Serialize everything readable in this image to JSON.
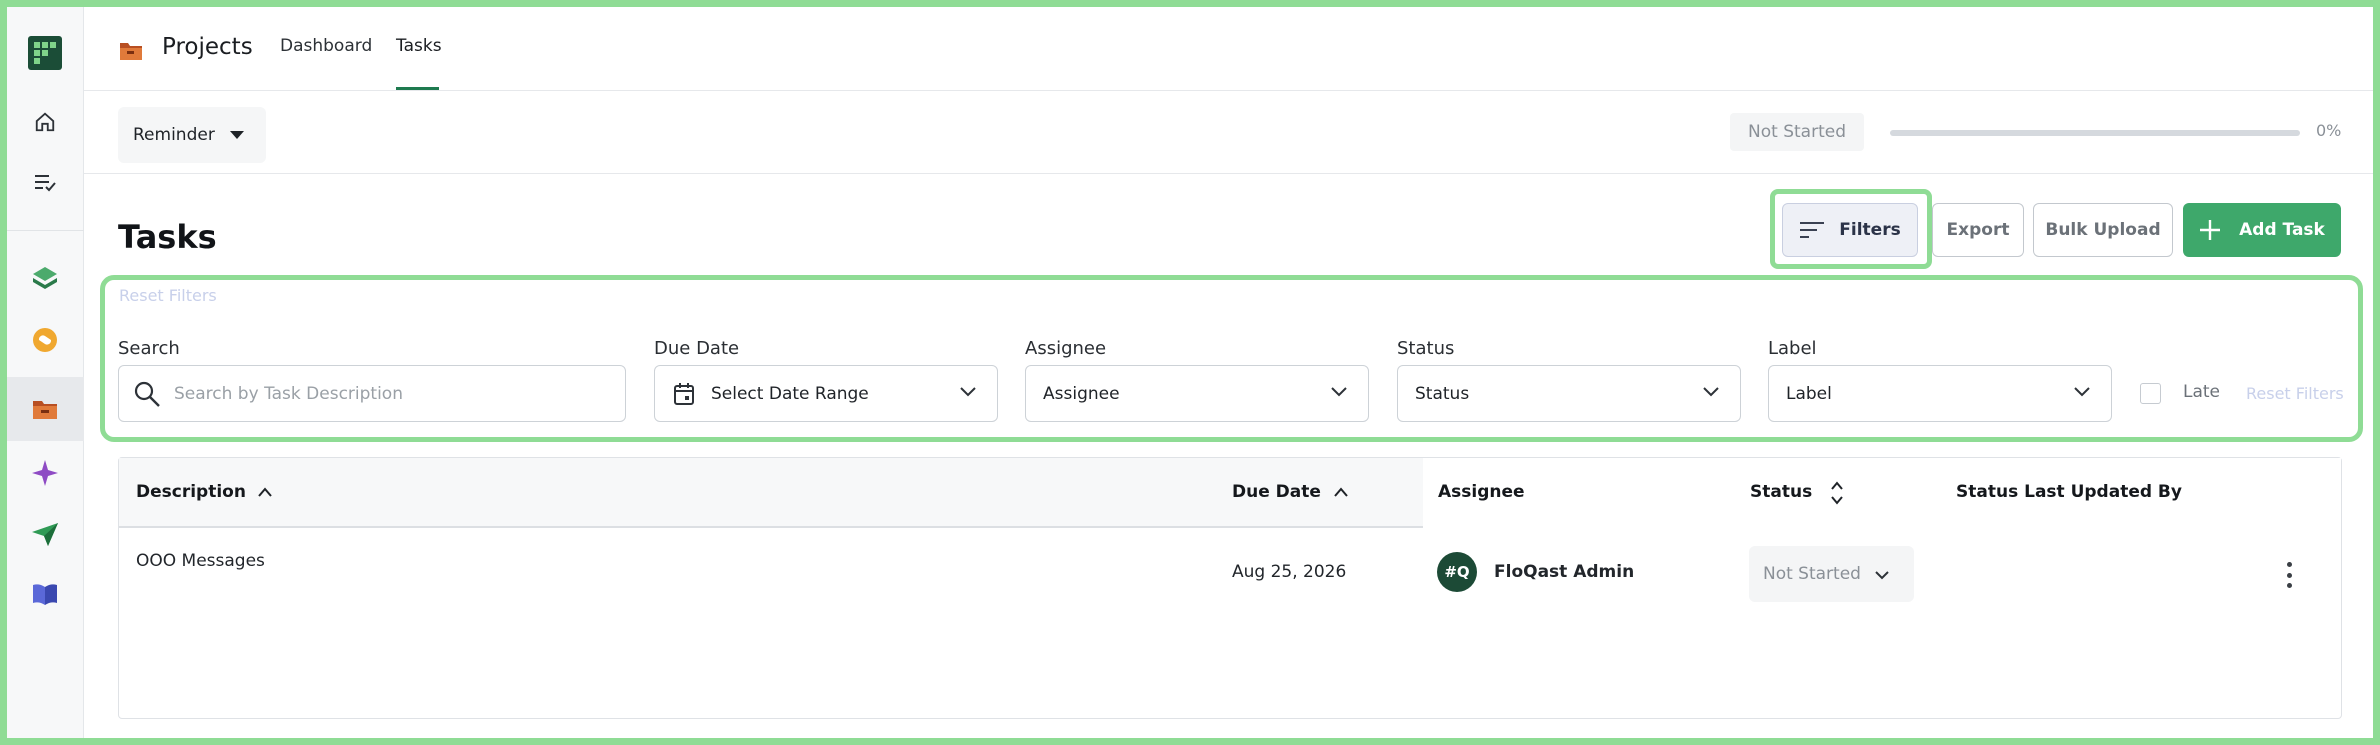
{
  "app": {
    "section_title": "Projects",
    "tabs": [
      {
        "label": "Dashboard",
        "active": false
      },
      {
        "label": "Tasks",
        "active": true
      }
    ]
  },
  "sidebar": {
    "items": [
      {
        "icon": "home-icon"
      },
      {
        "icon": "checklist-icon"
      },
      {
        "icon": "layers-icon"
      },
      {
        "icon": "link-icon"
      },
      {
        "icon": "folder-icon",
        "active": true
      },
      {
        "icon": "sparkle-icon"
      },
      {
        "icon": "send-icon"
      },
      {
        "icon": "book-icon"
      }
    ]
  },
  "reminder": {
    "label": "Reminder"
  },
  "project_status": {
    "label": "Not Started",
    "progress_percent": 0,
    "progress_text": "0%"
  },
  "tasks": {
    "title": "Tasks",
    "buttons": {
      "filters": "Filters",
      "export": "Export",
      "bulk_upload": "Bulk Upload",
      "add_task": "Add Task"
    }
  },
  "filters": {
    "reset_label": "Reset Filters",
    "search": {
      "label": "Search",
      "placeholder": "Search by Task Description"
    },
    "due_date": {
      "label": "Due Date",
      "value": "Select Date Range"
    },
    "assignee": {
      "label": "Assignee",
      "value": "Assignee"
    },
    "status": {
      "label": "Status",
      "value": "Status"
    },
    "label": {
      "label": "Label",
      "value": "Label"
    },
    "late": {
      "label": "Late",
      "checked": false
    }
  },
  "table": {
    "columns": {
      "description": "Description",
      "due_date": "Due Date",
      "assignee": "Assignee",
      "status": "Status",
      "status_last_updated_by": "Status Last Updated By"
    },
    "rows": [
      {
        "description": "OOO Messages",
        "due_date": "Aug 25, 2026",
        "assignee_initials": "#Q",
        "assignee": "FloQast Admin",
        "status": "Not Started",
        "status_last_updated_by": ""
      }
    ]
  },
  "colors": {
    "accent": "#3ea86b",
    "highlight": "#8fdc95",
    "tab_underline": "#1e7a4f"
  }
}
